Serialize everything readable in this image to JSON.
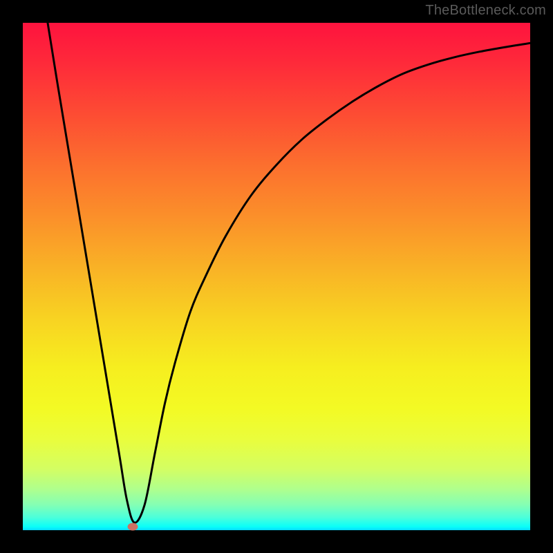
{
  "watermark": "TheBottleneck.com",
  "colors": {
    "frame": "#000000",
    "gradient_top": "#fe133e",
    "gradient_bottom": "#03dbff",
    "curve": "#000000",
    "marker": "#cb7163"
  },
  "chart_data": {
    "type": "line",
    "title": "",
    "xlabel": "",
    "ylabel": "",
    "xlim": [
      0,
      100
    ],
    "ylim": [
      0,
      100
    ],
    "series": [
      {
        "name": "bottleneck-curve",
        "x": [
          4.9,
          7,
          10,
          13,
          16,
          19,
          20.5,
          22,
          24,
          26,
          28,
          30,
          33,
          36,
          40,
          45,
          50,
          55,
          60,
          65,
          70,
          75,
          80,
          85,
          90,
          95,
          100
        ],
        "values": [
          100,
          87,
          69,
          51,
          33,
          15,
          6,
          1.5,
          5,
          15,
          25,
          33,
          43,
          50,
          58,
          66,
          72,
          77,
          81,
          84.5,
          87.5,
          90,
          91.8,
          93.2,
          94.3,
          95.2,
          96
        ]
      }
    ],
    "annotations": [
      {
        "name": "optimal-marker",
        "x": 21.6,
        "y": 0.7
      }
    ]
  }
}
